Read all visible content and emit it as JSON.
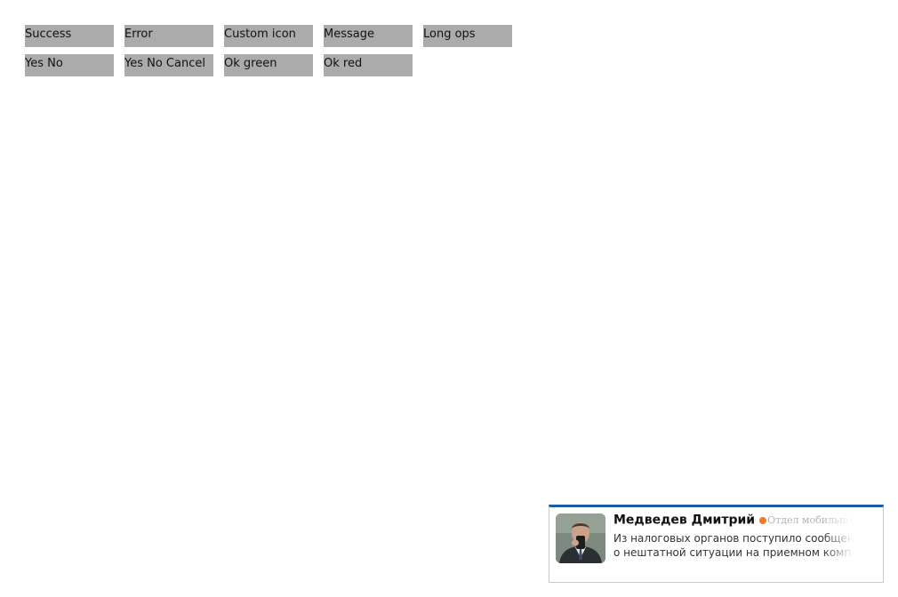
{
  "buttons": {
    "row1": [
      {
        "label": "Success"
      },
      {
        "label": "Error"
      },
      {
        "label": "Custom icon"
      },
      {
        "label": "Message"
      },
      {
        "label": "Long ops"
      }
    ],
    "row2": [
      {
        "label": "Yes No"
      },
      {
        "label": "Yes No Cancel"
      },
      {
        "label": "Ok green"
      },
      {
        "label": "Ok red"
      }
    ]
  },
  "notification": {
    "sender": "Медведев Дмитрий",
    "department": "Отдел мобильной разработки",
    "message_line1": "Из налоговых органов поступило сообщение",
    "message_line2": "о нештатной ситуации на приемном комплексе",
    "accent_color": "#1a5ea8",
    "status_color": "#f07a2a",
    "avatar_icon": "user-avatar-photo"
  }
}
